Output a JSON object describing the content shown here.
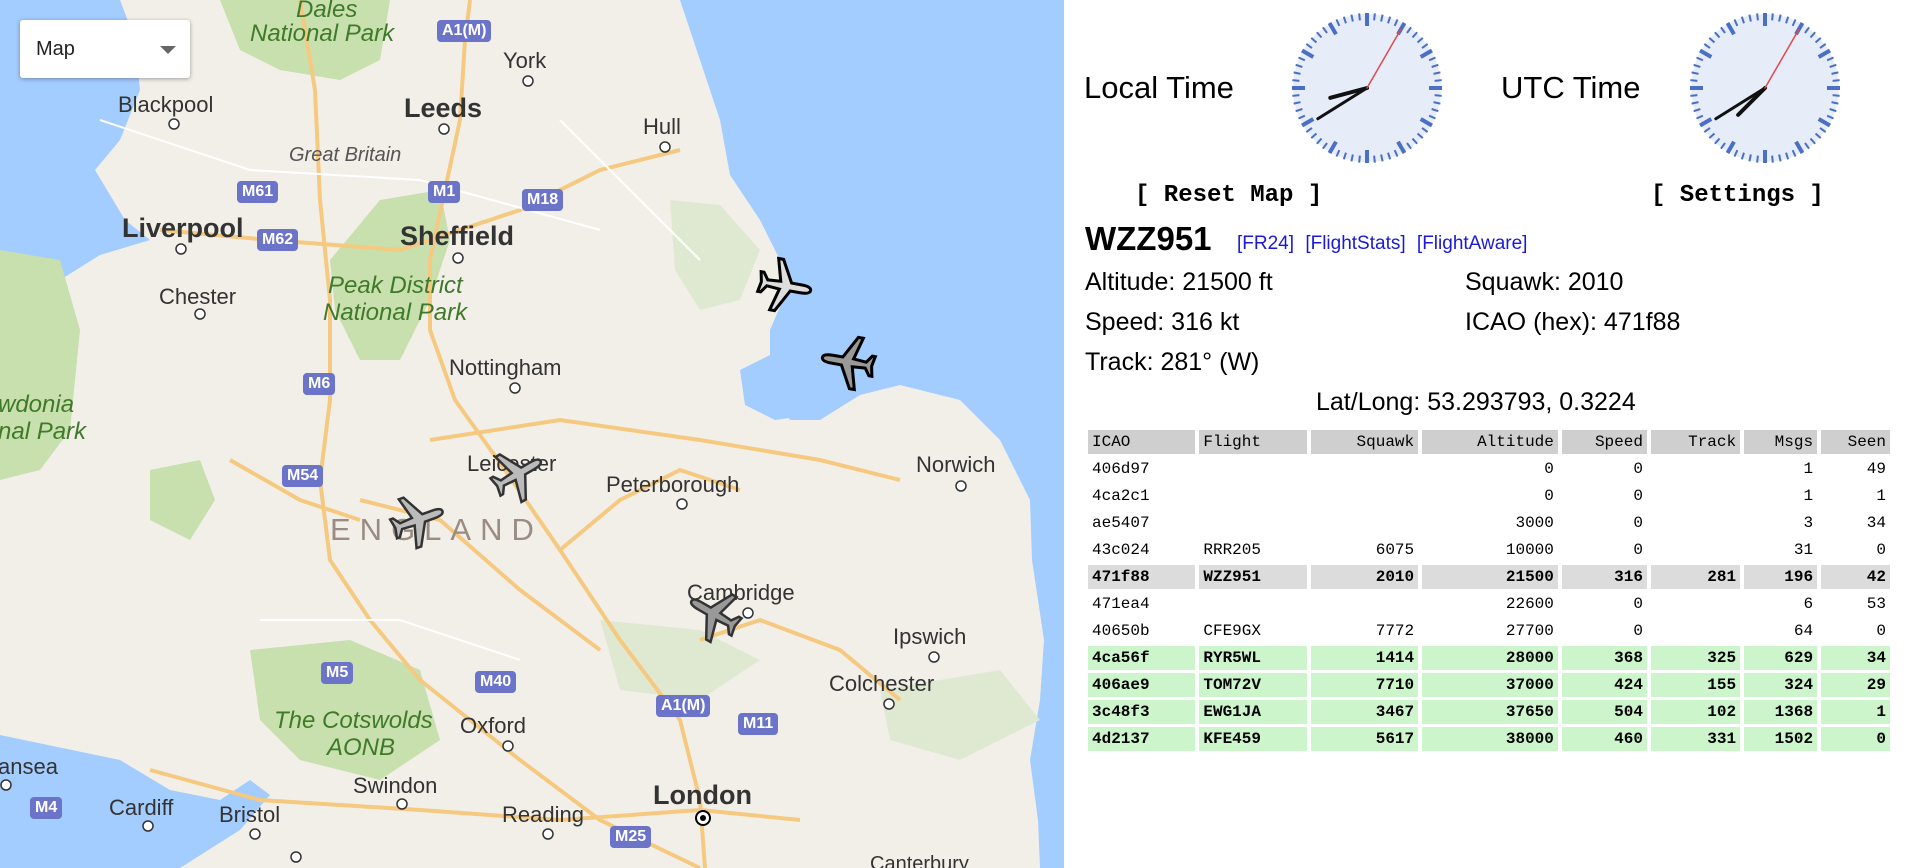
{
  "map": {
    "type_select": "Map",
    "places": {
      "dales": "Dales",
      "national_park_1": "National Park",
      "york": "York",
      "blackpool": "Blackpool",
      "leeds": "Leeds",
      "hull": "Hull",
      "great_britain": "Great Britain",
      "liverpool": "Liverpool",
      "sheffield": "Sheffield",
      "chester": "Chester",
      "peak_district": "Peak District",
      "national_park_2": "National Park",
      "nottingham": "Nottingham",
      "snowdonia": "wdonia",
      "snowdonia_np": "nal Park",
      "leicester": "Leicester",
      "peterborough": "Peterborough",
      "norwich": "Norwich",
      "england": "ENGLAND",
      "cambridge": "Cambridge",
      "ipswich": "Ipswich",
      "colchester": "Colchester",
      "cotswolds": "The Cotswolds",
      "aonb": "AONB",
      "oxford": "Oxford",
      "swansea": "ansea",
      "swindon": "Swindon",
      "cardiff": "Cardiff",
      "bristol": "Bristol",
      "reading": "Reading",
      "london": "London",
      "canterbury": "Canterbury"
    },
    "roads": {
      "a1m_north": "A1(M)",
      "m61": "M61",
      "m1": "M1",
      "m18": "M18",
      "m62": "M62",
      "m6": "M6",
      "m54": "M54",
      "m5": "M5",
      "m40": "M40",
      "a1m_south": "A1(M)",
      "m11": "M11",
      "m4": "M4",
      "m25": "M25"
    }
  },
  "clocks": {
    "local_label": "Local Time",
    "utc_label": "UTC Time",
    "local": {
      "hour_angle": 255,
      "minute_angle": 238,
      "second_angle": 30
    },
    "utc": {
      "hour_angle": 225,
      "minute_angle": 238,
      "second_angle": 30
    }
  },
  "buttons": {
    "reset_map": "[ Reset Map ]",
    "settings": "[ Settings ]"
  },
  "selected": {
    "flight": "WZZ951",
    "links": [
      "[FR24]",
      "[FlightStats]",
      "[FlightAware]"
    ],
    "altitude": "Altitude: 21500 ft",
    "squawk": "Squawk: 2010",
    "speed": "Speed: 316 kt",
    "icao": "ICAO (hex): 471f88",
    "track": "Track: 281° (W)",
    "latlong": "Lat/Long: 53.293793, 0.3224"
  },
  "table": {
    "headers": [
      "ICAO",
      "Flight",
      "Squawk",
      "Altitude",
      "Speed",
      "Track",
      "Msgs",
      "Seen"
    ],
    "rows": [
      {
        "state": "",
        "cells": [
          "406d97",
          "",
          "",
          "0",
          "0",
          "",
          "1",
          "49"
        ]
      },
      {
        "state": "",
        "cells": [
          "4ca2c1",
          "",
          "",
          "0",
          "0",
          "",
          "1",
          "1"
        ]
      },
      {
        "state": "",
        "cells": [
          "ae5407",
          "",
          "",
          "3000",
          "0",
          "",
          "3",
          "34"
        ]
      },
      {
        "state": "",
        "cells": [
          "43c024",
          "RRR205",
          "6075",
          "10000",
          "0",
          "",
          "31",
          "0"
        ]
      },
      {
        "state": "sel",
        "cells": [
          "471f88",
          "WZZ951",
          "2010",
          "21500",
          "316",
          "281",
          "196",
          "42"
        ]
      },
      {
        "state": "",
        "cells": [
          "471ea4",
          "",
          "",
          "22600",
          "0",
          "",
          "6",
          "53"
        ]
      },
      {
        "state": "",
        "cells": [
          "40650b",
          "CFE9GX",
          "7772",
          "27700",
          "0",
          "",
          "64",
          "0"
        ]
      },
      {
        "state": "pos",
        "cells": [
          "4ca56f",
          "RYR5WL",
          "1414",
          "28000",
          "368",
          "325",
          "629",
          "34"
        ]
      },
      {
        "state": "pos",
        "cells": [
          "406ae9",
          "TOM72V",
          "7710",
          "37000",
          "424",
          "155",
          "324",
          "29"
        ]
      },
      {
        "state": "pos",
        "cells": [
          "3c48f3",
          "EWG1JA",
          "3467",
          "37650",
          "504",
          "102",
          "1368",
          "1"
        ]
      },
      {
        "state": "pos",
        "cells": [
          "4d2137",
          "KFE459",
          "5617",
          "38000",
          "460",
          "331",
          "1502",
          "0"
        ]
      }
    ]
  },
  "colors": {
    "sea": "#a3ccff",
    "land": "#f2efe9",
    "park": "#c8dfae",
    "road": "#f6c980",
    "shield": "#6b74c9",
    "link": "#1a1ad6",
    "row_selected": "#dcdcdc",
    "row_positioned": "#ccf5cc"
  }
}
